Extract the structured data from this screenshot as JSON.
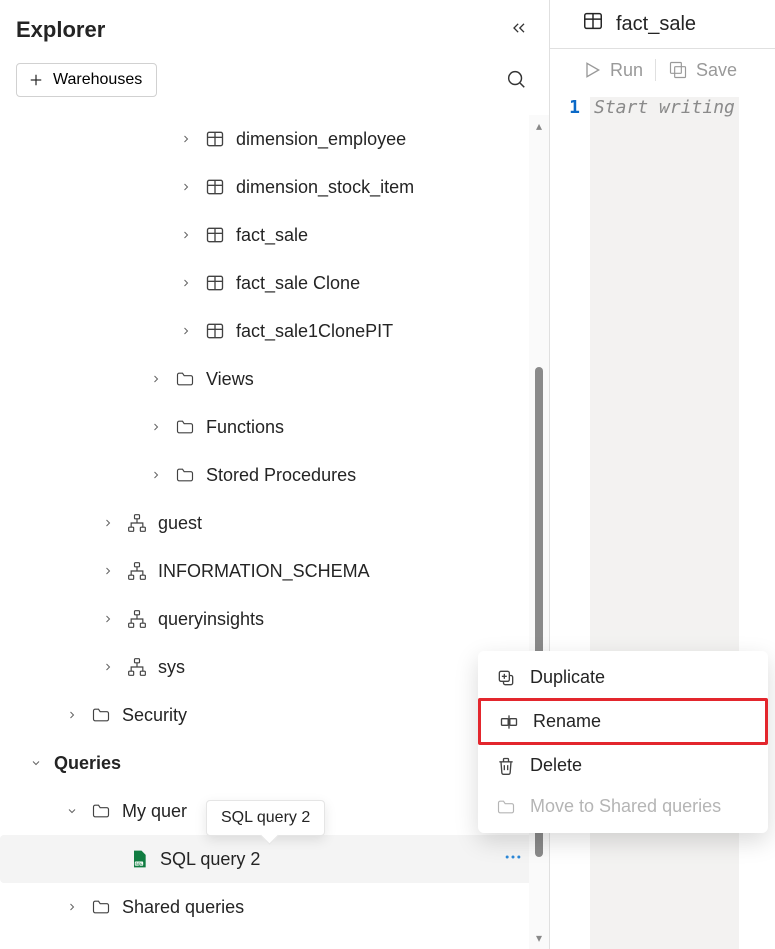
{
  "explorer": {
    "title": "Explorer",
    "warehouses_label": "Warehouses"
  },
  "tree": {
    "tables": [
      "dimension_employee",
      "dimension_stock_item",
      "fact_sale",
      "fact_sale Clone",
      "fact_sale1ClonePIT"
    ],
    "views_label": "Views",
    "functions_label": "Functions",
    "sprocs_label": "Stored Procedures",
    "schemas": [
      "guest",
      "INFORMATION_SCHEMA",
      "queryinsights",
      "sys"
    ],
    "security_label": "Security",
    "queries_label": "Queries",
    "my_queries_label": "My quer",
    "sql_query_label": "SQL query 2",
    "shared_queries_label": "Shared queries"
  },
  "tooltip": {
    "text": "SQL query 2"
  },
  "ctx": {
    "duplicate": "Duplicate",
    "rename": "Rename",
    "delete": "Delete",
    "move": "Move to Shared queries"
  },
  "editor": {
    "tab_label": "fact_sale",
    "run_label": "Run",
    "save_label": "Save",
    "line": "1",
    "placeholder": "Start writing"
  }
}
